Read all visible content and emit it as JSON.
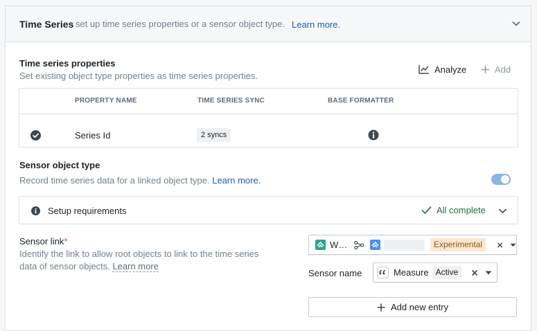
{
  "header": {
    "title": "Time Series",
    "subtitle": "- set up time series properties or a sensor object type.",
    "learn_more": "Learn more."
  },
  "ts_props": {
    "title": "Time series properties",
    "subtitle": "Set existing object type properties as time series properties.",
    "analyze_label": "Analyze",
    "add_label": "Add",
    "columns": [
      "PROPERTY NAME",
      "TIME SERIES SYNC",
      "BASE FORMATTER"
    ],
    "rows": [
      {
        "name": "Series Id",
        "sync": "2 syncs"
      }
    ]
  },
  "sensor": {
    "title": "Sensor object type",
    "subtitle": "Record time series data for a linked object type.",
    "learn_more": "Learn more.",
    "toggle_on": true
  },
  "setup": {
    "label": "Setup requirements",
    "status": "All complete"
  },
  "sensor_link": {
    "label": "Sensor link",
    "required_mark": "*",
    "help_line1": "Identify the link to allow root objects to link to the time series",
    "help_line2": "data of sensor objects.",
    "learn_more": "Learn more",
    "root_object": "W…",
    "badge": "Experimental"
  },
  "sensor_name": {
    "label": "Sensor name",
    "value": "Measure",
    "badge": "Active"
  },
  "add_entry_label": "Add new entry",
  "colors": {
    "accent_link": "#215db0",
    "success": "#1c6e42",
    "object_icon": "#2ca58d",
    "object_icon_alt": "#4c90f0",
    "experimental_bg": "#fbe7d4",
    "toggle_bg": "#8ab3e6"
  }
}
